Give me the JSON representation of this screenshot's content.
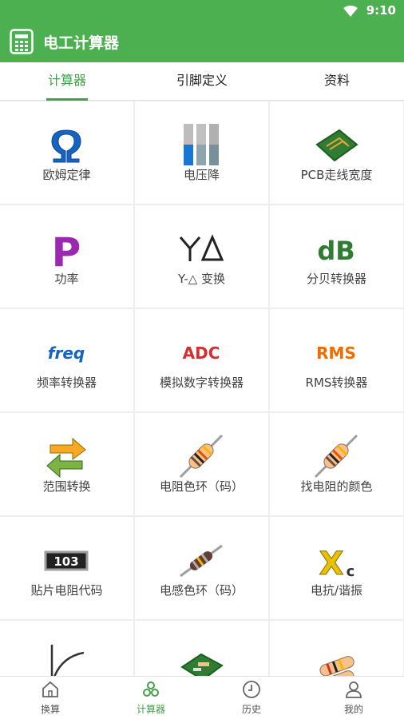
{
  "status": {
    "time": "9:10"
  },
  "app": {
    "title": "电工计算器"
  },
  "tabs": [
    {
      "label": "计算器",
      "active": true
    },
    {
      "label": "引脚定义",
      "active": false
    },
    {
      "label": "资料",
      "active": false
    }
  ],
  "items": [
    {
      "label": "欧姆定律",
      "icon": "omega-icon"
    },
    {
      "label": "电压降",
      "icon": "wires-icon"
    },
    {
      "label": "PCB走线宽度",
      "icon": "pcb-icon"
    },
    {
      "label": "功率",
      "icon": "p-letter-icon"
    },
    {
      "label": "Y-△ 变换",
      "icon": "y-delta-icon"
    },
    {
      "label": "分贝转换器",
      "icon": "db-icon"
    },
    {
      "label": "频率转换器",
      "icon": "freq-icon"
    },
    {
      "label": "模拟数字转换器",
      "icon": "adc-icon"
    },
    {
      "label": "RMS转换器",
      "icon": "rms-icon"
    },
    {
      "label": "范围转换",
      "icon": "swap-arrows-icon"
    },
    {
      "label": "电阻色环（码）",
      "icon": "resistor-icon"
    },
    {
      "label": "找电阻的颜色",
      "icon": "resistor-icon"
    },
    {
      "label": "贴片电阻代码",
      "icon": "smd-resistor-icon"
    },
    {
      "label": "电感色环（码）",
      "icon": "inductor-icon"
    },
    {
      "label": "电抗/谐振",
      "icon": "xc-icon"
    },
    {
      "label": "",
      "icon": "rc-curve-icon"
    },
    {
      "label": "",
      "icon": "circuit-board-icon"
    },
    {
      "label": "",
      "icon": "resistors-icon"
    }
  ],
  "icon_texts": {
    "smd": "103",
    "freq": "freq",
    "adc": "ADC",
    "rms": "RMS",
    "db": "dB",
    "p": "P",
    "xc_main": "X",
    "xc_sub": "c"
  },
  "bottom_nav": [
    {
      "label": "换算",
      "icon": "home-icon",
      "active": false
    },
    {
      "label": "计算器",
      "icon": "calculator-dots-icon",
      "active": true
    },
    {
      "label": "历史",
      "icon": "clock-icon",
      "active": false
    },
    {
      "label": "我的",
      "icon": "user-icon",
      "active": false
    }
  ],
  "colors": {
    "primary": "#4caf50",
    "accent": "#43a047"
  }
}
